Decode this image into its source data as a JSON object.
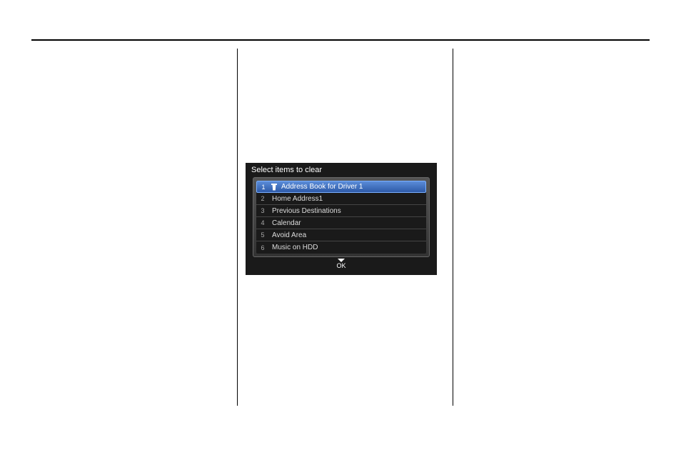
{
  "screenshot": {
    "title": "Select items to clear",
    "ok_label": "OK",
    "items": [
      {
        "num": "1",
        "label": "Address Book for Driver 1",
        "selected": true,
        "has_icon": true
      },
      {
        "num": "2",
        "label": "Home Address1",
        "selected": false,
        "has_icon": false
      },
      {
        "num": "3",
        "label": "Previous Destinations",
        "selected": false,
        "has_icon": false
      },
      {
        "num": "4",
        "label": "Calendar",
        "selected": false,
        "has_icon": false
      },
      {
        "num": "5",
        "label": "Avoid Area",
        "selected": false,
        "has_icon": false
      },
      {
        "num": "6",
        "label": "Music on HDD",
        "selected": false,
        "has_icon": false
      }
    ]
  }
}
